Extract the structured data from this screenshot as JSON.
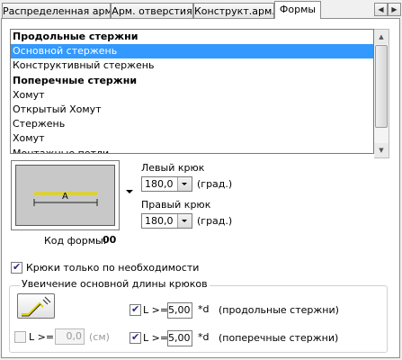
{
  "tabs": [
    {
      "label": "Распределенная арм."
    },
    {
      "label": "Арм. отверстия"
    },
    {
      "label": "Конструкт.арм."
    },
    {
      "label": "Формы"
    }
  ],
  "shape_list": [
    {
      "label": "Продольные стержни",
      "type": "header"
    },
    {
      "label": "Основной стержень",
      "type": "item",
      "selected": true
    },
    {
      "label": "Конструктивный стержень",
      "type": "item"
    },
    {
      "label": "Поперечные стержни",
      "type": "header"
    },
    {
      "label": "Хомут",
      "type": "item"
    },
    {
      "label": "Открытый Хомут",
      "type": "item"
    },
    {
      "label": "Стержень",
      "type": "item"
    },
    {
      "label": "Хомут",
      "type": "item"
    },
    {
      "label": "Монтажные петли",
      "type": "item"
    }
  ],
  "preview": {
    "segment_label": "A"
  },
  "left_hook": {
    "label": "Левый крюк",
    "value": "180,0",
    "unit": "(град.)"
  },
  "right_hook": {
    "label": "Правый крюк",
    "value": "180,0",
    "unit": "(град.)"
  },
  "shape_code": {
    "label": "Код формы:",
    "value": "00"
  },
  "hooks_only_needed": {
    "label": "Крюки только по необходимости",
    "checked": true
  },
  "hook_length_group": {
    "title": "Увеичение основной длины крюков",
    "longitudinal": {
      "prefix": "L >=",
      "value": "5,00",
      "suffix": "*d",
      "note": "(продольные стержни)",
      "checked": true
    },
    "transverse": {
      "prefix": "L >=",
      "value": "5,00",
      "suffix": "*d",
      "note": "(поперечные стержни)",
      "checked": true
    },
    "absolute": {
      "prefix": "L >=",
      "value": "0,0",
      "unit": "(см)",
      "checked": false
    }
  },
  "colors": {
    "selection": "#3399ff",
    "bar": "#f0e020"
  }
}
